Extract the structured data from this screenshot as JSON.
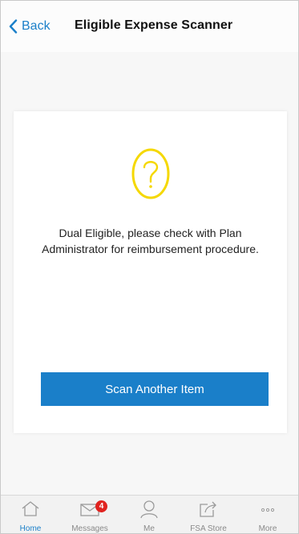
{
  "header": {
    "back_label": "Back",
    "title": "Eligible Expense Scanner"
  },
  "result": {
    "icon": "question-circle-icon",
    "icon_color": "#f5d800",
    "message": "Dual Eligible, please check with Plan Administrator for reimbursement procedure.",
    "button_label": "Scan Another Item",
    "button_color": "#1a7fc9"
  },
  "tabbar": {
    "items": [
      {
        "label": "Home",
        "icon": "home-icon",
        "active": true
      },
      {
        "label": "Messages",
        "icon": "envelope-icon",
        "badge": "4"
      },
      {
        "label": "Me",
        "icon": "person-icon"
      },
      {
        "label": "FSA Store",
        "icon": "external-link-icon"
      },
      {
        "label": "More",
        "icon": "more-dots-icon"
      }
    ]
  }
}
